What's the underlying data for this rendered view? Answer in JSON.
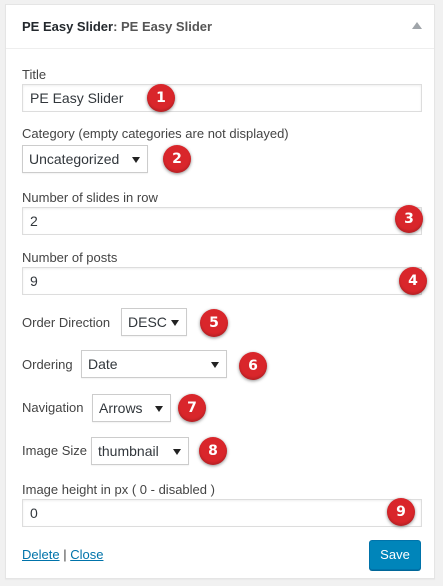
{
  "widget": {
    "title": "PE Easy Slider",
    "title_suffix": ": PE Easy Slider"
  },
  "fields": {
    "title": {
      "label": "Title",
      "value": "PE Easy Slider"
    },
    "category": {
      "label": "Category (empty categories are not displayed)",
      "value": "Uncategorized"
    },
    "slides_in_row": {
      "label": "Number of slides in row",
      "value": "2"
    },
    "posts": {
      "label": "Number of posts",
      "value": "9"
    },
    "order_direction": {
      "label": "Order Direction",
      "value": "DESC"
    },
    "ordering": {
      "label": "Ordering",
      "value": "Date"
    },
    "navigation": {
      "label": "Navigation",
      "value": "Arrows"
    },
    "image_size": {
      "label": "Image Size",
      "value": "thumbnail"
    },
    "image_height": {
      "label": "Image height in px ( 0 - disabled )",
      "value": "0"
    }
  },
  "badges": [
    "1",
    "2",
    "3",
    "4",
    "5",
    "6",
    "7",
    "8",
    "9"
  ],
  "footer": {
    "delete_label": "Delete",
    "separator": "|",
    "close_label": "Close",
    "save_label": "Save"
  },
  "colors": {
    "badge": "#d9262b",
    "link": "#0073aa",
    "primary_button": "#0085ba"
  }
}
